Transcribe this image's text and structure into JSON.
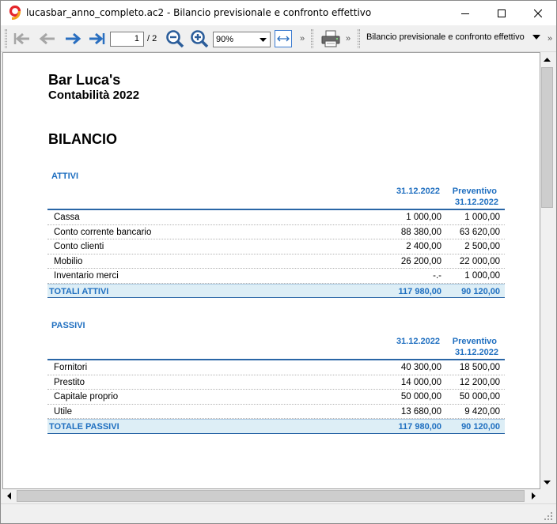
{
  "window": {
    "title": "lucasbar_anno_completo.ac2 - Bilancio previsionale e confronto effettivo"
  },
  "toolbar": {
    "page_current": "1",
    "page_total": "/ 2",
    "zoom": "90%",
    "overflow_label": "»",
    "report_name": "Bilancio previsionale e confronto effettivo"
  },
  "document": {
    "company": "Bar Luca's",
    "subtitle": "Contabilità 2022",
    "heading": "BILANCIO",
    "col_actual": "31.12.2022",
    "col_budget_line1": "Preventivo",
    "col_budget_line2": "31.12.2022",
    "attivi": {
      "title": "ATTIVI",
      "rows": [
        {
          "label": "Cassa",
          "actual": "1 000,00",
          "budget": "1 000,00"
        },
        {
          "label": "Conto corrente bancario",
          "actual": "88 380,00",
          "budget": "63 620,00"
        },
        {
          "label": "Conto clienti",
          "actual": "2 400,00",
          "budget": "2 500,00"
        },
        {
          "label": "Mobilio",
          "actual": "26 200,00",
          "budget": "22 000,00"
        },
        {
          "label": "Inventario merci",
          "actual": "-.-",
          "budget": "1 000,00"
        }
      ],
      "total": {
        "label": "TOTALI ATTIVI",
        "actual": "117 980,00",
        "budget": "90 120,00"
      }
    },
    "passivi": {
      "title": "PASSIVI",
      "rows": [
        {
          "label": "Fornitori",
          "actual": "40 300,00",
          "budget": "18 500,00"
        },
        {
          "label": "Prestito",
          "actual": "14 000,00",
          "budget": "12 200,00"
        },
        {
          "label": "Capitale proprio",
          "actual": "50 000,00",
          "budget": "50 000,00"
        },
        {
          "label": "Utile",
          "actual": "13 680,00",
          "budget": "9 420,00"
        }
      ],
      "total": {
        "label": "TOTALE PASSIVI",
        "actual": "117 980,00",
        "budget": "90 120,00"
      }
    }
  },
  "colors": {
    "accent_blue": "#1f6fc0",
    "total_row_bg": "#ddeef6",
    "nav_arrow_blue": "#2a6fc0"
  }
}
